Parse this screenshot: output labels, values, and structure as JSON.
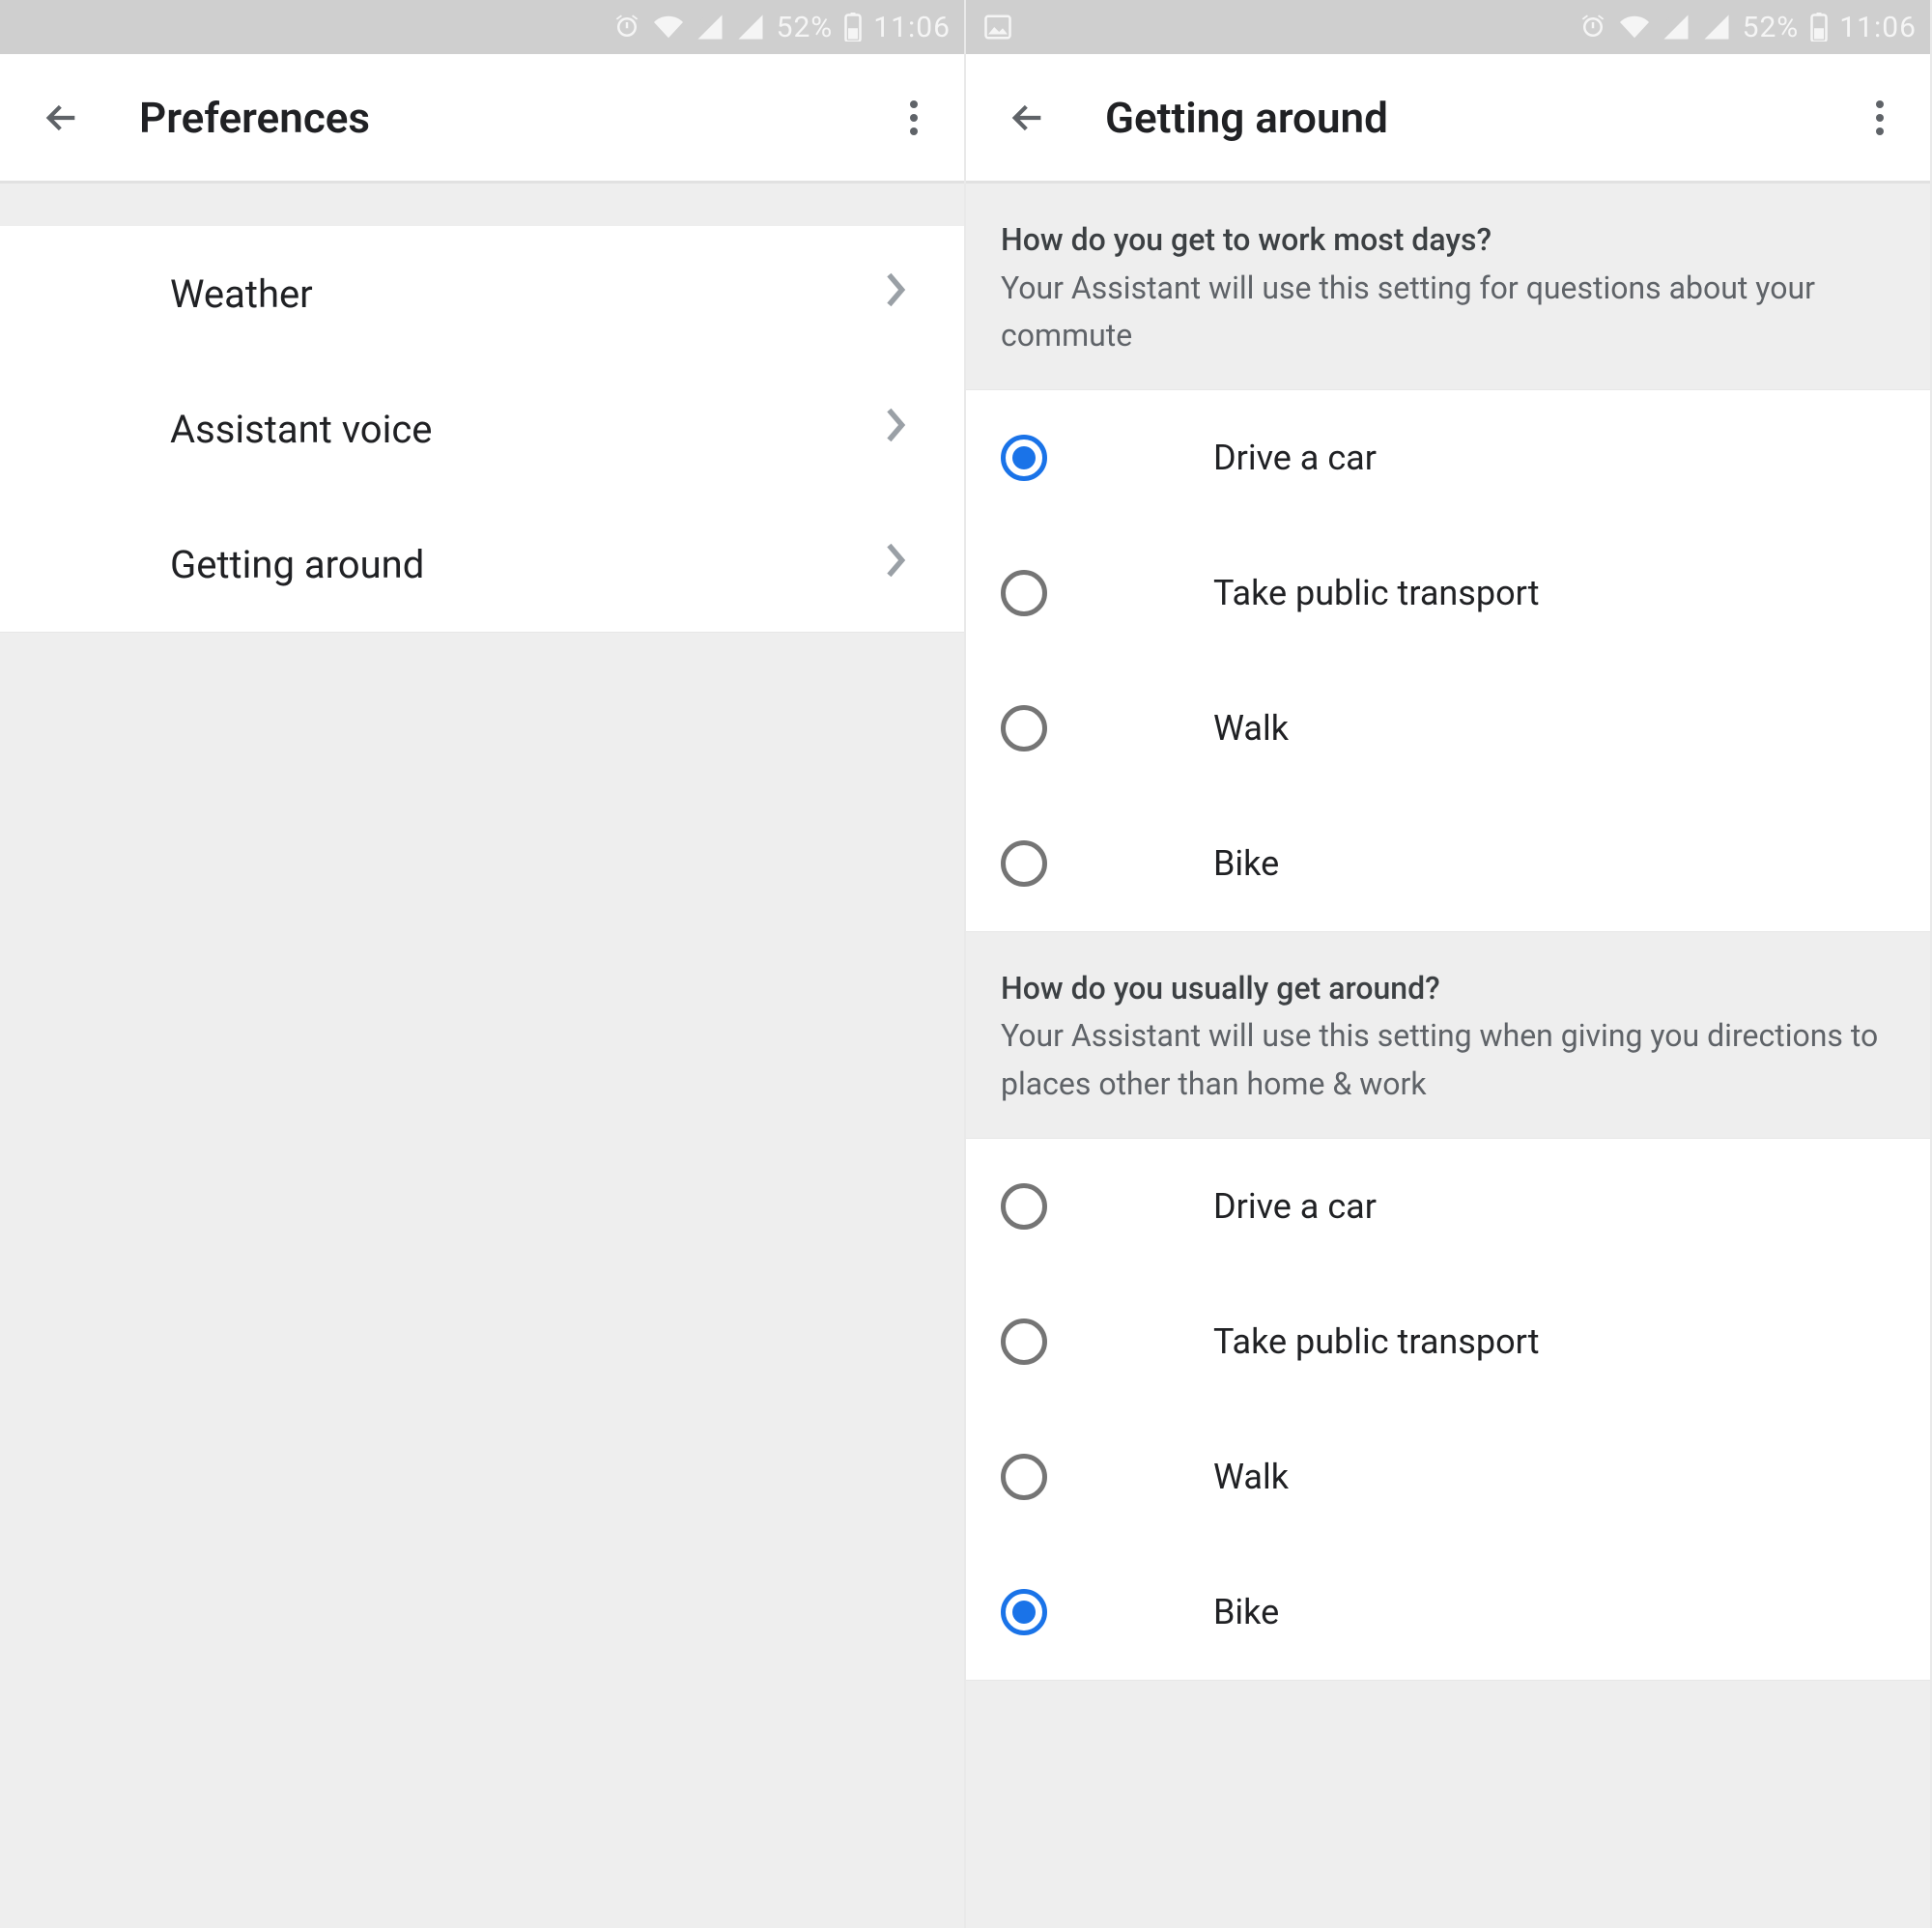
{
  "status": {
    "battery_pct": "52%",
    "time": "11:06"
  },
  "left": {
    "title": "Preferences",
    "items": [
      {
        "label": "Weather"
      },
      {
        "label": "Assistant voice"
      },
      {
        "label": "Getting around"
      }
    ]
  },
  "right": {
    "title": "Getting around",
    "sections": [
      {
        "question": "How do you get to work most days?",
        "subtitle": "Your Assistant will use this setting for questions about your commute",
        "options": [
          {
            "label": "Drive a car",
            "selected": true
          },
          {
            "label": "Take public transport",
            "selected": false
          },
          {
            "label": "Walk",
            "selected": false
          },
          {
            "label": "Bike",
            "selected": false
          }
        ]
      },
      {
        "question": "How do you usually get around?",
        "subtitle": "Your Assistant will use this setting when giving you directions to places other than home & work",
        "options": [
          {
            "label": "Drive a car",
            "selected": false
          },
          {
            "label": "Take public transport",
            "selected": false
          },
          {
            "label": "Walk",
            "selected": false
          },
          {
            "label": "Bike",
            "selected": true
          }
        ]
      }
    ]
  }
}
